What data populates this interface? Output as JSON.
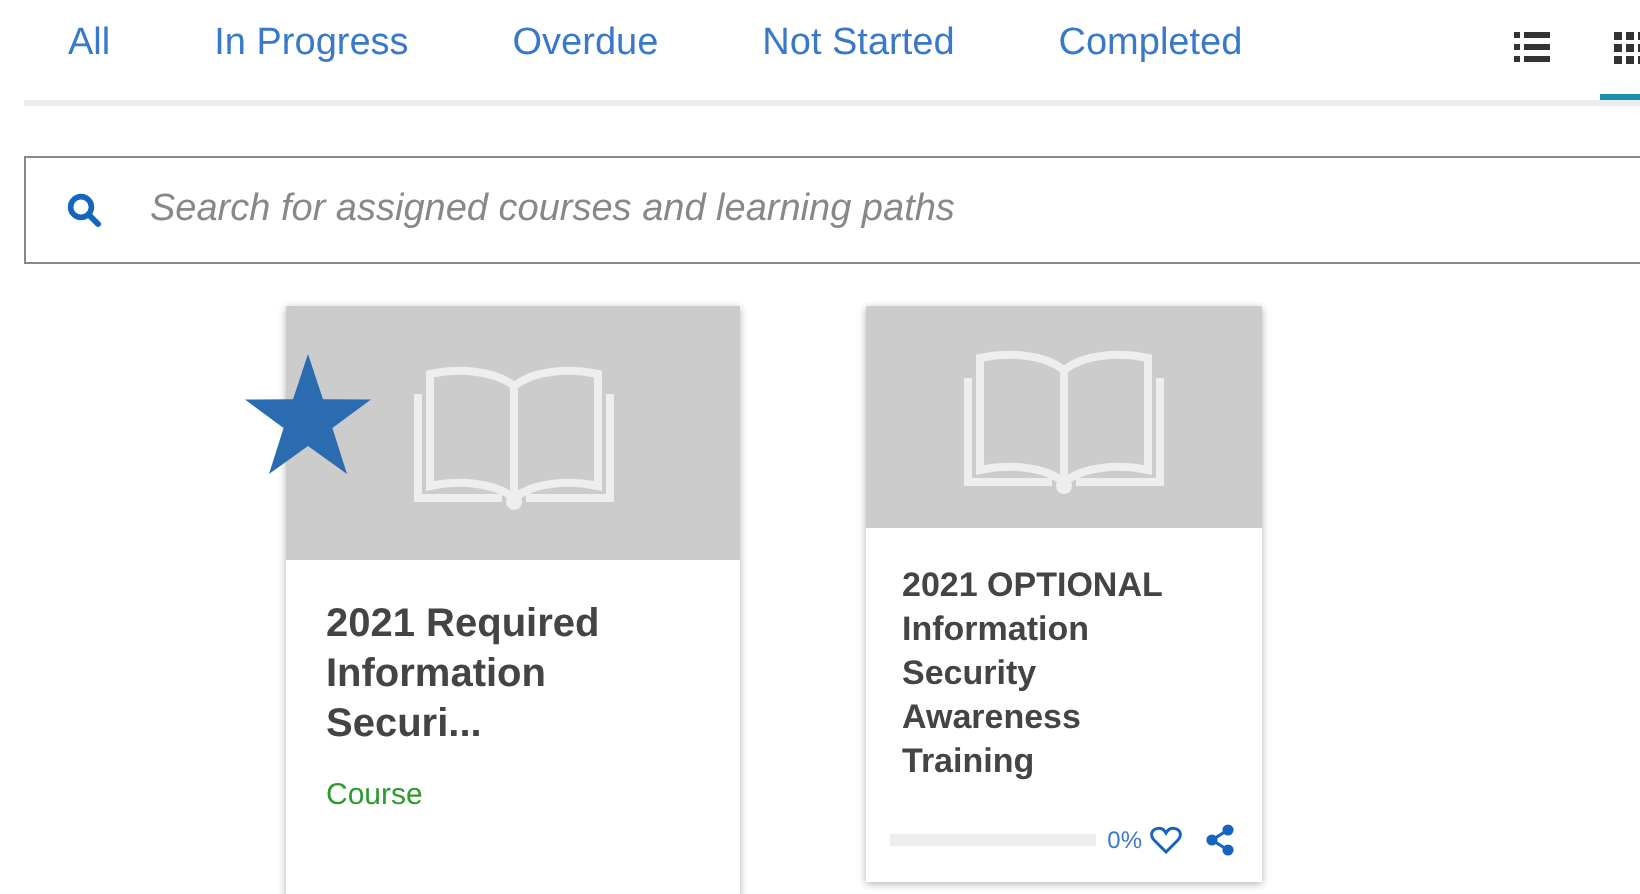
{
  "tabs": [
    {
      "label": "All",
      "selected": false
    },
    {
      "label": "In Progress",
      "selected": false
    },
    {
      "label": "Overdue",
      "selected": false
    },
    {
      "label": "Not Started",
      "selected": false
    },
    {
      "label": "Completed",
      "selected": false
    }
  ],
  "views": [
    {
      "kind": "list",
      "selected": false
    },
    {
      "kind": "grid",
      "selected": true
    }
  ],
  "search": {
    "placeholder": "Search for assigned courses and learning paths"
  },
  "cards": [
    {
      "kind": "typed",
      "starred": true,
      "title": "2021 Required Information Securi...",
      "type": "Course"
    },
    {
      "kind": "progress",
      "starred": false,
      "title": "2021 OPTIONAL Information Security Awareness Training",
      "progress": {
        "level": 0,
        "reading": "0%"
      }
    }
  ]
}
